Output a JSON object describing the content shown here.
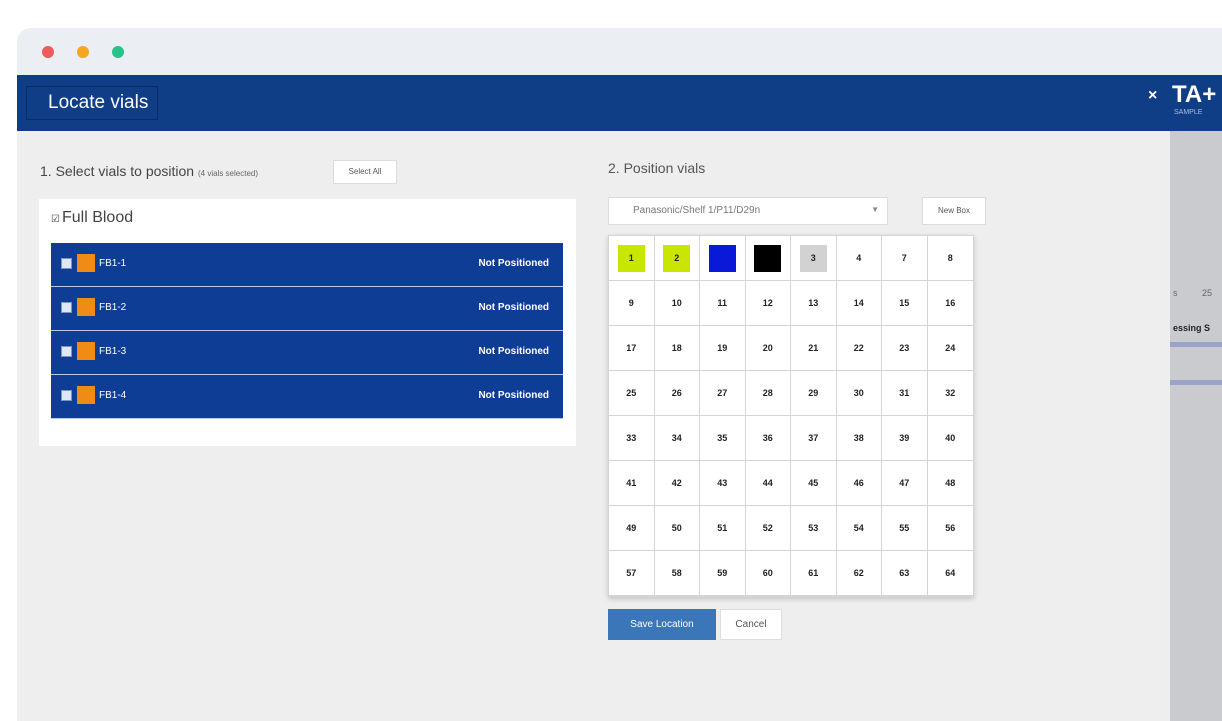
{
  "modal": {
    "title": "Locate vials",
    "close_symbol": "×"
  },
  "section1": {
    "title": "1. Select vials to position",
    "selected_count": "(4 vials selected)",
    "select_all_label": "Select All",
    "group": {
      "checkbox_symbol": "☑",
      "label": "Full Blood",
      "vials": [
        {
          "name": "FB1-1",
          "status": "Not Positioned",
          "color": "#ef8c15"
        },
        {
          "name": "FB1-2",
          "status": "Not Positioned",
          "color": "#ef8c15"
        },
        {
          "name": "FB1-3",
          "status": "Not Positioned",
          "color": "#ef8c15"
        },
        {
          "name": "FB1-4",
          "status": "Not Positioned",
          "color": "#ef8c15"
        }
      ]
    }
  },
  "section2": {
    "title": "2. Position vials",
    "location": "Panasonic/Shelf 1/P11/D29n",
    "new_box_label": "New Box",
    "cells": [
      {
        "label": "1",
        "color": "#c8e600"
      },
      {
        "label": "2",
        "color": "#c8e600"
      },
      {
        "label": "",
        "color": "#0a19d8"
      },
      {
        "label": "",
        "color": "#000000"
      },
      {
        "label": "3",
        "color": "#d2d2d2"
      },
      {
        "label": "4"
      },
      {
        "label": "7"
      },
      {
        "label": "8"
      },
      {
        "label": "9"
      },
      {
        "label": "10"
      },
      {
        "label": "11"
      },
      {
        "label": "12"
      },
      {
        "label": "13"
      },
      {
        "label": "14"
      },
      {
        "label": "15"
      },
      {
        "label": "16"
      },
      {
        "label": "17"
      },
      {
        "label": "18"
      },
      {
        "label": "19"
      },
      {
        "label": "20"
      },
      {
        "label": "21"
      },
      {
        "label": "22"
      },
      {
        "label": "23"
      },
      {
        "label": "24"
      },
      {
        "label": "25"
      },
      {
        "label": "26"
      },
      {
        "label": "27"
      },
      {
        "label": "28"
      },
      {
        "label": "29"
      },
      {
        "label": "30"
      },
      {
        "label": "31"
      },
      {
        "label": "32"
      },
      {
        "label": "33"
      },
      {
        "label": "34"
      },
      {
        "label": "35"
      },
      {
        "label": "36"
      },
      {
        "label": "37"
      },
      {
        "label": "38"
      },
      {
        "label": "39"
      },
      {
        "label": "40"
      },
      {
        "label": "41"
      },
      {
        "label": "42"
      },
      {
        "label": "43"
      },
      {
        "label": "44"
      },
      {
        "label": "45"
      },
      {
        "label": "46"
      },
      {
        "label": "47"
      },
      {
        "label": "48"
      },
      {
        "label": "49"
      },
      {
        "label": "50"
      },
      {
        "label": "51"
      },
      {
        "label": "52"
      },
      {
        "label": "53"
      },
      {
        "label": "54"
      },
      {
        "label": "55"
      },
      {
        "label": "56"
      },
      {
        "label": "57"
      },
      {
        "label": "58"
      },
      {
        "label": "59"
      },
      {
        "label": "60"
      },
      {
        "label": "61"
      },
      {
        "label": "62"
      },
      {
        "label": "63"
      },
      {
        "label": "64"
      }
    ],
    "save_label": "Save Location",
    "cancel_label": "Cancel"
  },
  "background_app": {
    "logo": "TA+",
    "logo_sub": "SAMPLE",
    "header_text": "essing S",
    "tab_text": "s",
    "tab_value": "25"
  }
}
